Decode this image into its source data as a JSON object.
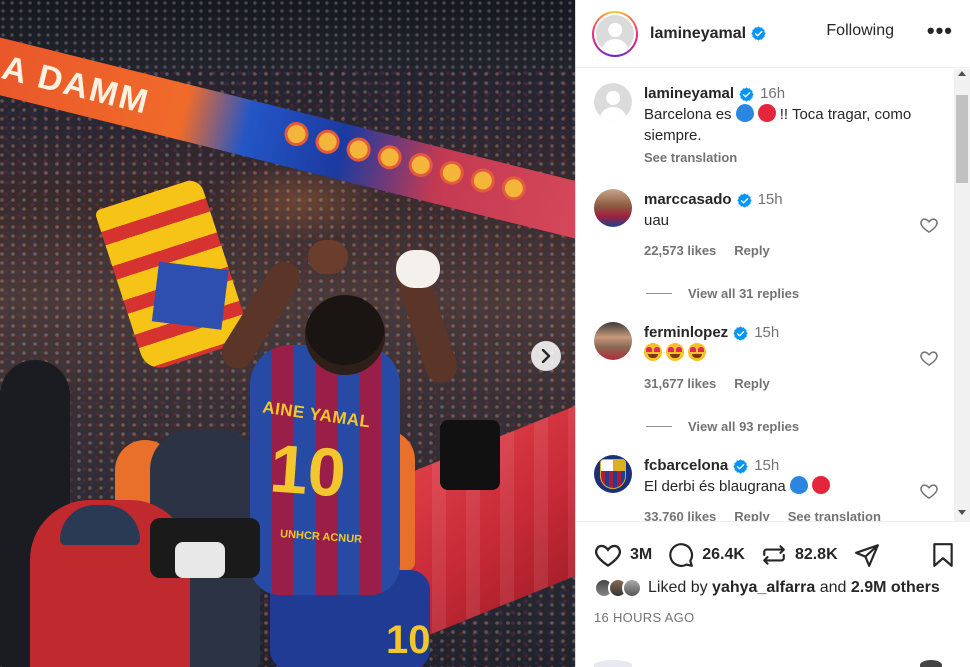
{
  "photo": {
    "banner_text": "LA DAMM",
    "jersey_name": "AINE YAMAL",
    "jersey_number": "10",
    "jersey_tag": "UNHCR ACNUR",
    "shorts_number": "10",
    "next_icon": "chevron-right-icon"
  },
  "header": {
    "username": "lamineyamal",
    "follow_state": "Following",
    "more_icon": "•••"
  },
  "caption": {
    "username": "lamineyamal",
    "time": "16h",
    "text_before": "Barcelona es",
    "text_after": "!! Toca tragar, como siempre.",
    "see_translation": "See translation"
  },
  "comments": [
    {
      "username": "marccasado",
      "time": "15h",
      "text": "uau",
      "likes": "22,573 likes",
      "reply": "Reply",
      "view_replies": "View all 31 replies"
    },
    {
      "username": "ferminlopez",
      "time": "15h",
      "likes": "31,677 likes",
      "reply": "Reply",
      "view_replies": "View all 93 replies"
    },
    {
      "username": "fcbarcelona",
      "time": "15h",
      "text": "El derbi és blaugrana",
      "likes": "33,760 likes",
      "reply": "Reply",
      "see_translation": "See translation"
    }
  ],
  "actions": {
    "likes_count": "3M",
    "comments_count": "26.4K",
    "reposts_count": "82.8K"
  },
  "liked_by": {
    "prefix": "Liked by",
    "user": "yahya_alfarra",
    "middle": "and",
    "others": "2.9M others"
  },
  "posted_ago": "16 HOURS AGO",
  "colors": {
    "verified": "#0095f6",
    "text": "#262626",
    "secondary": "#737373"
  }
}
